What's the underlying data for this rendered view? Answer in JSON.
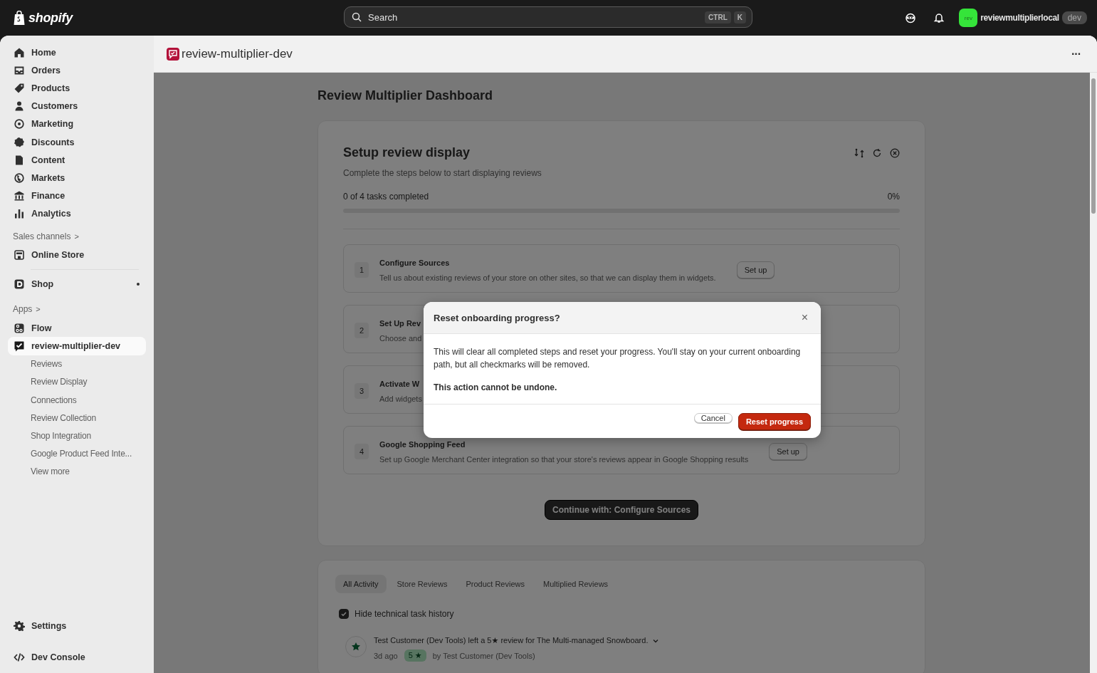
{
  "topbar": {
    "logo": "shopify",
    "search": {
      "placeholder": "Search",
      "keys": [
        "CTRL",
        "K"
      ]
    },
    "store": {
      "avatar": "rev",
      "name": "reviewmultiplierlocal",
      "badge": "dev"
    }
  },
  "sidebar": {
    "main": [
      {
        "label": "Home",
        "selected": false
      },
      {
        "label": "Orders",
        "selected": false
      },
      {
        "label": "Products",
        "selected": false
      },
      {
        "label": "Customers",
        "selected": false
      },
      {
        "label": "Marketing",
        "selected": false
      },
      {
        "label": "Discounts",
        "selected": false
      },
      {
        "label": "Content",
        "selected": false
      },
      {
        "label": "Markets",
        "selected": false
      },
      {
        "label": "Finance",
        "selected": false
      },
      {
        "label": "Analytics",
        "selected": false
      }
    ],
    "sales_channels": {
      "label": "Sales channels",
      "chevron": ">",
      "items": [
        {
          "label": "Online Store",
          "selected": false
        }
      ]
    },
    "shop": {
      "label": "Shop",
      "dot": true,
      "selected": false
    },
    "apps": {
      "label": "Apps",
      "chevron": ">",
      "items": [
        {
          "label": "Flow",
          "selected": false
        },
        {
          "label": "review-multiplier-dev",
          "selected": true,
          "children": [
            {
              "label": "Reviews",
              "selected": false
            },
            {
              "label": "Review Display",
              "selected": false
            },
            {
              "label": "Connections",
              "selected": false
            },
            {
              "label": "Review Collection",
              "selected": false
            },
            {
              "label": "Shop Integration",
              "selected": false
            },
            {
              "label": "Google Product Feed Inte...",
              "selected": false
            },
            {
              "label": "View more",
              "selected": false
            }
          ]
        }
      ]
    },
    "bottom": [
      {
        "label": "Settings",
        "selected": false
      },
      {
        "label": "Dev Console",
        "selected": false
      }
    ]
  },
  "page_header": {
    "title": "review-multiplier-dev",
    "menu": "···"
  },
  "dashboard": {
    "title": "Review Multiplier Dashboard",
    "setup": {
      "title": "Setup review display",
      "subtitle": "Complete the steps below to start displaying reviews",
      "progress_text": "0 of 4 tasks completed",
      "percent": "0%",
      "level": 0,
      "steps": [
        {
          "number": "1",
          "title": "Configure Sources",
          "description": "Tell us about existing reviews of your store on other sites, so that we can display them in widgets.",
          "button": "Set up"
        },
        {
          "number": "2",
          "title": "Set Up Rev",
          "description": "Choose and"
        },
        {
          "number": "3",
          "title": "Activate W",
          "description": "Add widgets"
        },
        {
          "number": "4",
          "title": "Google Shopping Feed",
          "description": "Set up Google Merchant Center integration so that your store's reviews appear in Google Shopping results",
          "button": "Set up"
        }
      ],
      "continue_button": "Continue with: Configure Sources"
    },
    "activity": {
      "tabs": [
        {
          "label": "All Activity",
          "selected": true
        },
        {
          "label": "Store Reviews",
          "selected": false
        },
        {
          "label": "Product Reviews",
          "selected": false
        },
        {
          "label": "Multiplied Reviews",
          "selected": false
        }
      ],
      "hide_technical": {
        "label": "Hide technical task history",
        "checked": true
      },
      "items": [
        {
          "text": "Test Customer (Dev Tools) left a 5★ review for The Multi-managed Snowboard.",
          "time": "3d ago",
          "rating": "5 ★",
          "author": "by Test Customer (Dev Tools)"
        }
      ]
    }
  },
  "dialog": {
    "title": "Reset onboarding progress?",
    "close": "×",
    "body": "This will clear all completed steps and reset your progress. You'll stay on your current onboarding path, but all checkmarks will be removed.",
    "warning": "This action cannot be undone.",
    "buttons": [
      {
        "label": "Cancel",
        "kind": "secondary"
      },
      {
        "label": "Reset progress",
        "kind": "critical"
      }
    ]
  }
}
